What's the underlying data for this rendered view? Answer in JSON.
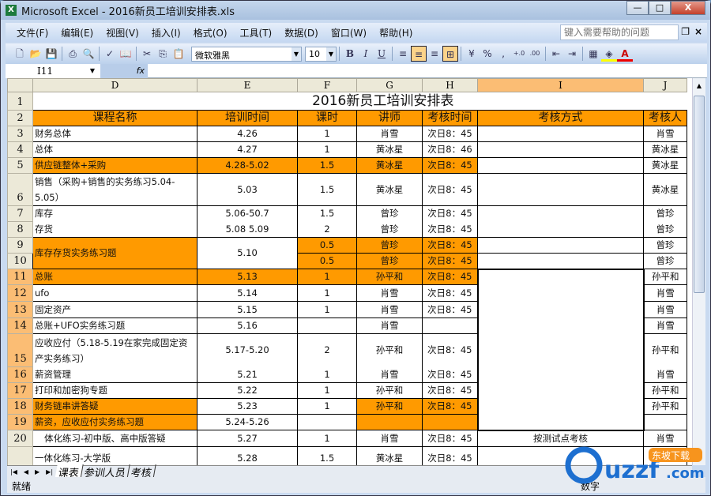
{
  "window": {
    "title": "Microsoft Excel - 2016新员工培训安排表.xls",
    "min": "—",
    "max": "□",
    "close": "X"
  },
  "menu": [
    "文件(F)",
    "编辑(E)",
    "视图(V)",
    "插入(I)",
    "格式(O)",
    "工具(T)",
    "数据(D)",
    "窗口(W)",
    "帮助(H)"
  ],
  "help_placeholder": "键入需要帮助的问题",
  "toolbar": {
    "font": "微软雅黑",
    "size": "10",
    "bold": "B",
    "italic": "I",
    "underline": "U",
    "percent": "%",
    "comma": ",",
    "inc_decimal": "+.0",
    "dec_decimal": ".00",
    "font_color": "A"
  },
  "formula": {
    "name_box": "I11",
    "fx": "fx",
    "value": ""
  },
  "columns": [
    "D",
    "E",
    "F",
    "G",
    "H",
    "I",
    "J"
  ],
  "selected_column": "I",
  "colors": {
    "highlight": "#ff9a00",
    "selected_header": "#fbbd74"
  },
  "title": "2016新员工培训安排表",
  "headers": [
    "课程名称",
    "培训时间",
    "课时",
    "讲师",
    "考核时间",
    "考核方式",
    "考核人"
  ],
  "rows": [
    {
      "n": "3",
      "c": [
        "财务总体",
        "4.26",
        "1",
        "肖雪",
        "次日8：45",
        "",
        "肖雪"
      ]
    },
    {
      "n": "4",
      "c": [
        "总体",
        "4.27",
        "1",
        "黄冰星",
        "次日8：46",
        "",
        "黄冰星"
      ]
    },
    {
      "n": "5",
      "c": [
        "供应链整体+采购",
        "4.28-5.02",
        "1.5",
        "黄冰星",
        "次日8：45",
        "",
        "黄冰星"
      ]
    },
    {
      "n": "6",
      "c": [
        "销售（采购+销售的实务练习5.04-5.05）",
        "5.03",
        "1.5",
        "黄冰星",
        "次日8：45",
        "",
        "黄冰星"
      ]
    },
    {
      "n": "7",
      "c": [
        "库存",
        "5.06-50.7",
        "1.5",
        "曾珍",
        "次日8：45",
        "",
        "曾珍"
      ]
    },
    {
      "n": "8",
      "c": [
        "存货",
        "5.08  5.09",
        "2",
        "曾珍",
        "次日8：45",
        "",
        "曾珍"
      ]
    },
    {
      "n": "9",
      "c": [
        "库存存货实务练习题",
        "5.10",
        "0.5",
        "曾珍",
        "次日8：45",
        "",
        "曾珍"
      ]
    },
    {
      "n": "10",
      "c": [
        "",
        "",
        "0.5",
        "曾珍",
        "次日8：45",
        "",
        "曾珍"
      ]
    },
    {
      "n": "11",
      "c": [
        "总账",
        "5.13",
        "1",
        "孙平和",
        "次日8：45",
        "",
        "孙平和"
      ]
    },
    {
      "n": "12",
      "c": [
        "ufo",
        "5.14",
        "1",
        "肖雪",
        "次日8：45",
        "",
        "肖雪"
      ]
    },
    {
      "n": "13",
      "c": [
        "固定资产",
        "5.15",
        "1",
        "肖雪",
        "次日8：45",
        "",
        "肖雪"
      ]
    },
    {
      "n": "14",
      "c": [
        "总账+UFO实务练习题",
        "5.16",
        "",
        "肖雪",
        "",
        "",
        "肖雪"
      ]
    },
    {
      "n": "15",
      "c": [
        "应收应付（5.18-5.19在家完成固定资产实务练习）",
        "5.17-5.20",
        "2",
        "孙平和",
        "次日8：45",
        "",
        "孙平和"
      ]
    },
    {
      "n": "16",
      "c": [
        "薪资管理",
        "5.21",
        "1",
        "肖雪",
        "次日8：45",
        "",
        "肖雪"
      ]
    },
    {
      "n": "17",
      "c": [
        "打印和加密狗专题",
        "5.22",
        "1",
        "孙平和",
        "次日8：45",
        "",
        "孙平和"
      ]
    },
    {
      "n": "18",
      "c": [
        "财务链串讲答疑",
        "5.23",
        "1",
        "孙平和",
        "次日8：45",
        "",
        "孙平和"
      ]
    },
    {
      "n": "19",
      "c": [
        "薪资，应收应付实务练习题",
        "5.24-5.26",
        "",
        "",
        "",
        "",
        ""
      ]
    },
    {
      "n": "20",
      "c": [
        "体化练习-初中版、高中版答疑",
        "5.27",
        "1",
        "肖雪",
        "次日8：45",
        "按测试点考核",
        "肖雪"
      ]
    },
    {
      "n": "",
      "c": [
        "一体化练习-大学版",
        "5.28",
        "1.5",
        "黄冰星",
        "次日8：45",
        "",
        ""
      ]
    }
  ],
  "sheet_tabs": [
    "课表",
    "参训人员",
    "考核"
  ],
  "active_tab": "课表",
  "status": {
    "ready": "就绪",
    "num": "数字"
  },
  "watermark": "uzzf.com 东坡下载"
}
